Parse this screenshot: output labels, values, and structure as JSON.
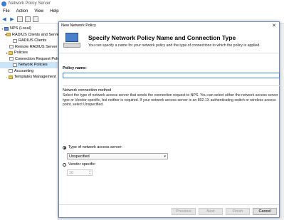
{
  "app": {
    "title": "Network Policy Server",
    "menu": [
      "File",
      "Action",
      "View",
      "Help"
    ]
  },
  "tree": {
    "items": [
      {
        "label": "NPS (Local)",
        "icon": "server-icon",
        "indent": 0,
        "toggle": "▾"
      },
      {
        "label": "RADIUS Clients and Servers",
        "icon": "folder-icon",
        "indent": 1,
        "toggle": "▾"
      },
      {
        "label": "RADIUS Clients",
        "icon": "doc-icon",
        "indent": 2,
        "toggle": ""
      },
      {
        "label": "Remote RADIUS Server Groups",
        "icon": "doc-icon",
        "indent": 2,
        "toggle": ""
      },
      {
        "label": "Policies",
        "icon": "folder-icon",
        "indent": 1,
        "toggle": "▾"
      },
      {
        "label": "Connection Request Policies",
        "icon": "doc-icon",
        "indent": 2,
        "toggle": ""
      },
      {
        "label": "Network Policies",
        "icon": "doc-icon",
        "indent": 2,
        "toggle": "",
        "selected": true
      },
      {
        "label": "Accounting",
        "icon": "doc-icon",
        "indent": 1,
        "toggle": ""
      },
      {
        "label": "Templates Management",
        "icon": "folder-icon",
        "indent": 1,
        "toggle": "›"
      }
    ]
  },
  "dialog": {
    "title": "New Network Policy",
    "heading": "Specify Network Policy Name and Connection Type",
    "subheading": "You can specify a name for your network policy and the type of connections to which the policy is applied.",
    "policy_name_label": "Policy name:",
    "policy_name_value": "",
    "method_label": "Network connection method",
    "method_description": "Select the type of network access server that sends the connection request to NPS. You can select either the network access server type or Vendor specific, but neither is required.  If your network access server is an 802.1X authenticating switch or wireless access point, select Unspecified.",
    "type_label": "Type of network access server:",
    "type_value": "Unspecified",
    "vendor_label": "Vendor specific:",
    "vendor_value": "10",
    "buttons": {
      "previous": "Previous",
      "next": "Next",
      "finish": "Finish",
      "cancel": "Cancel"
    }
  }
}
